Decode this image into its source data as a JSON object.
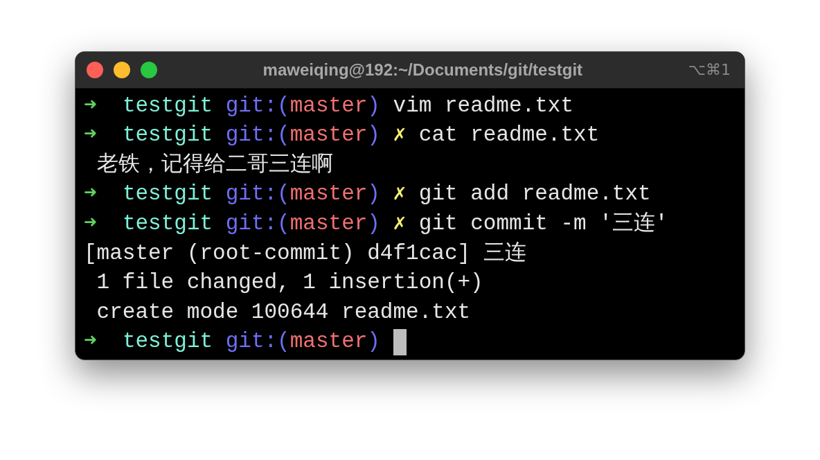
{
  "window": {
    "title": "maweiqing@192:~/Documents/git/testgit",
    "shortcut": "⌥⌘1"
  },
  "lines": [
    {
      "kind": "prompt",
      "arrow": "➜",
      "directory": "testgit",
      "git_open": "git:(",
      "branch": "master",
      "git_close": ")",
      "command": "vim readme.txt",
      "cursor": false
    },
    {
      "kind": "prompt",
      "arrow": "➜",
      "directory": "testgit",
      "git_open": "git:(",
      "branch": "master",
      "git_close": ")",
      "dirty_mark": "✗",
      "command": "cat readme.txt",
      "cursor": false
    },
    {
      "kind": "output",
      "text": " 老铁，记得给二哥三连啊"
    },
    {
      "kind": "prompt",
      "arrow": "➜",
      "directory": "testgit",
      "git_open": "git:(",
      "branch": "master",
      "git_close": ")",
      "dirty_mark": "✗",
      "command": "git add readme.txt",
      "cursor": false
    },
    {
      "kind": "prompt",
      "arrow": "➜",
      "directory": "testgit",
      "git_open": "git:(",
      "branch": "master",
      "git_close": ")",
      "dirty_mark": "✗",
      "command": "git commit -m '三连'",
      "cursor": false
    },
    {
      "kind": "output",
      "text": "[master (root-commit) d4f1cac] 三连"
    },
    {
      "kind": "output",
      "text": " 1 file changed, 1 insertion(+)"
    },
    {
      "kind": "output",
      "text": " create mode 100644 readme.txt"
    },
    {
      "kind": "prompt",
      "arrow": "➜",
      "directory": "testgit",
      "git_open": "git:(",
      "branch": "master",
      "git_close": ")",
      "cursor": true
    }
  ]
}
